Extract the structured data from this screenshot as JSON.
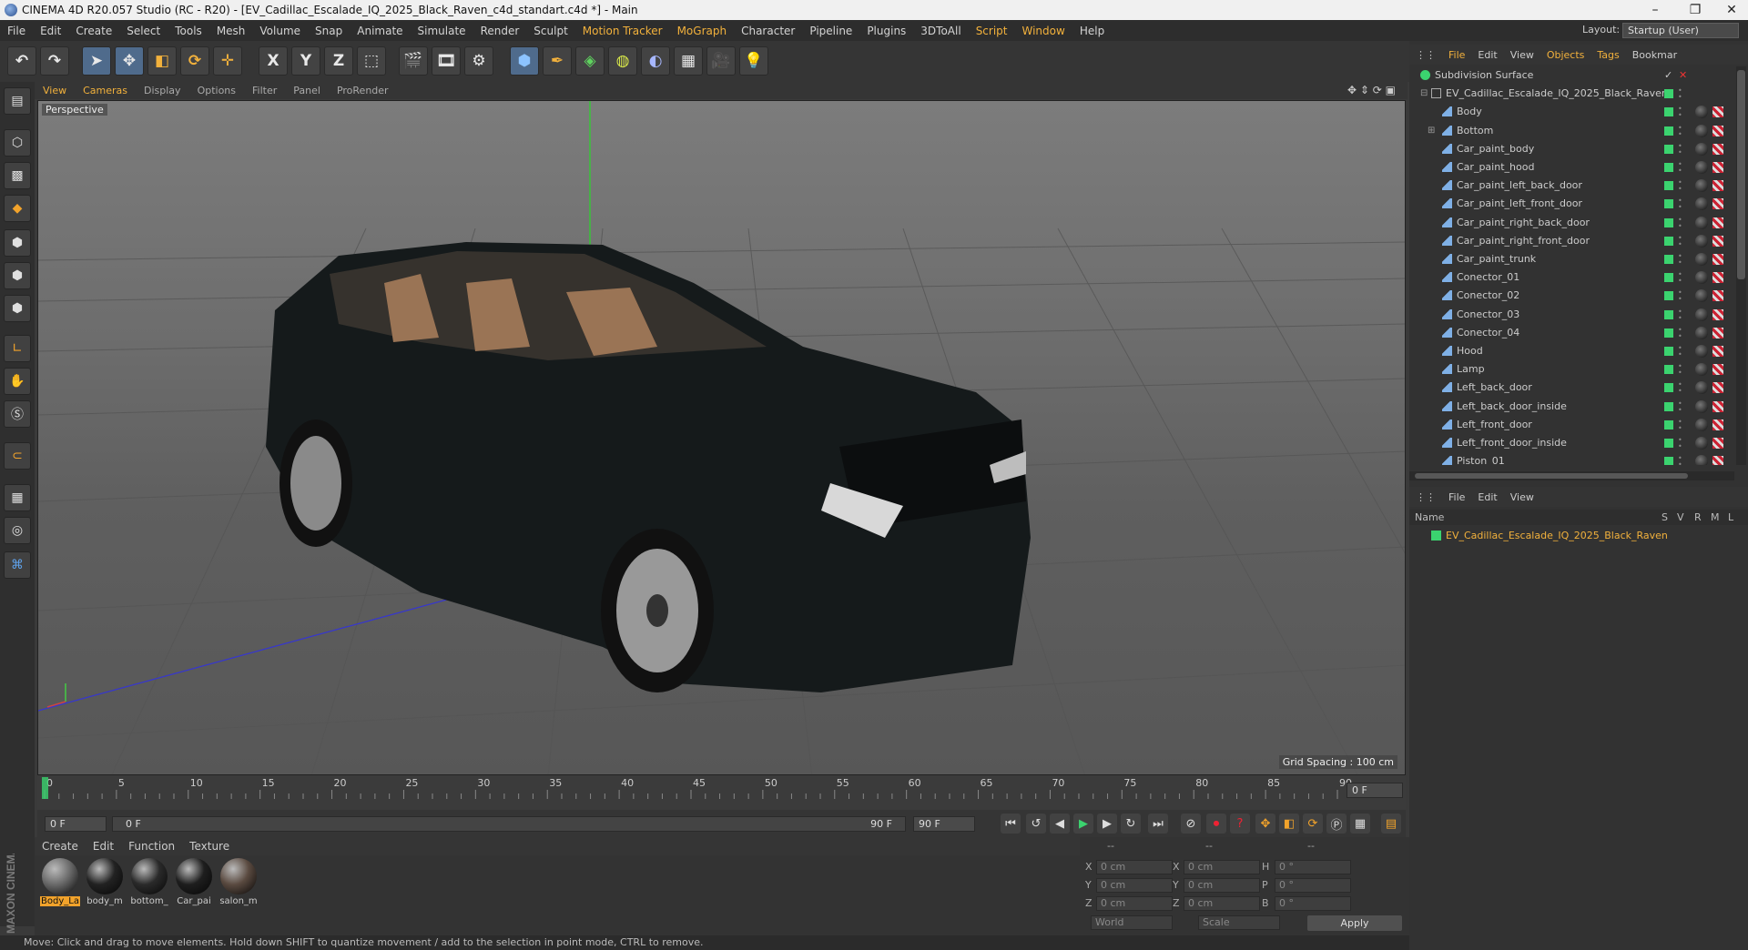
{
  "window": {
    "title": "CINEMA 4D R20.057 Studio (RC - R20) - [EV_Cadillac_Escalade_IQ_2025_Black_Raven_c4d_standart.c4d *] - Main"
  },
  "menubar": [
    {
      "label": "File"
    },
    {
      "label": "Edit"
    },
    {
      "label": "Create"
    },
    {
      "label": "Select"
    },
    {
      "label": "Tools"
    },
    {
      "label": "Mesh"
    },
    {
      "label": "Volume"
    },
    {
      "label": "Snap"
    },
    {
      "label": "Animate"
    },
    {
      "label": "Simulate"
    },
    {
      "label": "Render"
    },
    {
      "label": "Sculpt"
    },
    {
      "label": "Motion Tracker",
      "hl": true
    },
    {
      "label": "MoGraph",
      "hl": true
    },
    {
      "label": "Character"
    },
    {
      "label": "Pipeline"
    },
    {
      "label": "Plugins"
    },
    {
      "label": "3DToAll"
    },
    {
      "label": "Script",
      "hl": true
    },
    {
      "label": "Window",
      "hl": true
    },
    {
      "label": "Help"
    }
  ],
  "layout": {
    "label": "Layout:",
    "value": "Startup (User)"
  },
  "toolbar": {
    "x_axis": "X",
    "y_axis": "Y",
    "z_axis": "Z"
  },
  "viewport": {
    "menu": [
      "View",
      "Cameras",
      "Display",
      "Options",
      "Filter",
      "Panel",
      "ProRender"
    ],
    "camera_label": "Perspective",
    "grid_spacing": "Grid Spacing : 100 cm"
  },
  "timeline": {
    "ticks": [
      "0",
      "5",
      "10",
      "15",
      "20",
      "25",
      "30",
      "35",
      "40",
      "45",
      "50",
      "55",
      "60",
      "65",
      "70",
      "75",
      "80",
      "85",
      "90"
    ],
    "current_frame": "0 F",
    "start_field": "0 F",
    "range_start": "0 F",
    "range_end": "90 F",
    "end_field": "90 F"
  },
  "materials": {
    "menu": [
      "Create",
      "Edit",
      "Function",
      "Texture"
    ],
    "items": [
      {
        "label": "Body_La",
        "selected": true,
        "color": "#6a6a6a"
      },
      {
        "label": "body_m",
        "selected": false,
        "color": "#222"
      },
      {
        "label": "bottom_",
        "selected": false,
        "color": "#2a2a2a"
      },
      {
        "label": "Car_pai",
        "selected": false,
        "color": "#1e1e1e"
      },
      {
        "label": "salon_m",
        "selected": false,
        "color": "#5a4a40"
      }
    ]
  },
  "coords": {
    "headers": [
      "--",
      "--",
      "--"
    ],
    "rows": [
      {
        "a": "X",
        "av": "0 cm",
        "b": "X",
        "bv": "0 cm",
        "c": "H",
        "cv": "0 °"
      },
      {
        "a": "Y",
        "av": "0 cm",
        "b": "Y",
        "bv": "0 cm",
        "c": "P",
        "cv": "0 °"
      },
      {
        "a": "Z",
        "av": "0 cm",
        "b": "Z",
        "bv": "0 cm",
        "c": "B",
        "cv": "0 °"
      }
    ],
    "world": "World",
    "scale": "Scale",
    "apply": "Apply"
  },
  "status": "Move: Click and drag to move elements. Hold down SHIFT to quantize movement / add to the selection in point mode, CTRL to remove.",
  "brand": "MAXON CINEMA 4D",
  "objects_panel": {
    "menu": [
      {
        "label": "File",
        "hl": true
      },
      {
        "label": "Edit"
      },
      {
        "label": "View"
      },
      {
        "label": "Objects",
        "hl": true
      },
      {
        "label": "Tags",
        "hl": true
      },
      {
        "label": "Bookmar"
      }
    ],
    "items": [
      {
        "name": "Subdivision Surface",
        "depth": 0,
        "type": "subdiv"
      },
      {
        "name": "EV_Cadillac_Escalade_IQ_2025_Black_Raven",
        "depth": 1,
        "type": "null"
      },
      {
        "name": "Body",
        "depth": 2,
        "type": "poly"
      },
      {
        "name": "Bottom",
        "depth": 2,
        "type": "poly",
        "expand": true
      },
      {
        "name": "Car_paint_body",
        "depth": 2,
        "type": "poly"
      },
      {
        "name": "Car_paint_hood",
        "depth": 2,
        "type": "poly"
      },
      {
        "name": "Car_paint_left_back_door",
        "depth": 2,
        "type": "poly"
      },
      {
        "name": "Car_paint_left_front_door",
        "depth": 2,
        "type": "poly"
      },
      {
        "name": "Car_paint_right_back_door",
        "depth": 2,
        "type": "poly"
      },
      {
        "name": "Car_paint_right_front_door",
        "depth": 2,
        "type": "poly"
      },
      {
        "name": "Car_paint_trunk",
        "depth": 2,
        "type": "poly"
      },
      {
        "name": "Conector_01",
        "depth": 2,
        "type": "poly"
      },
      {
        "name": "Conector_02",
        "depth": 2,
        "type": "poly"
      },
      {
        "name": "Conector_03",
        "depth": 2,
        "type": "poly"
      },
      {
        "name": "Conector_04",
        "depth": 2,
        "type": "poly"
      },
      {
        "name": "Hood",
        "depth": 2,
        "type": "poly"
      },
      {
        "name": "Lamp",
        "depth": 2,
        "type": "poly"
      },
      {
        "name": "Left_back_door",
        "depth": 2,
        "type": "poly"
      },
      {
        "name": "Left_back_door_inside",
        "depth": 2,
        "type": "poly"
      },
      {
        "name": "Left_front_door",
        "depth": 2,
        "type": "poly"
      },
      {
        "name": "Left_front_door_inside",
        "depth": 2,
        "type": "poly"
      },
      {
        "name": "Piston_01",
        "depth": 2,
        "type": "poly"
      }
    ]
  },
  "layers_panel": {
    "menu": [
      {
        "label": "File"
      },
      {
        "label": "Edit"
      },
      {
        "label": "View"
      }
    ],
    "headers": {
      "name": "Name",
      "s": "S",
      "v": "V",
      "r": "R",
      "m": "M",
      "l": "L"
    },
    "items": [
      {
        "name": "EV_Cadillac_Escalade_IQ_2025_Black_Raven"
      }
    ]
  },
  "colors": {
    "accent": "#f2b13c",
    "active": "#3bd36f"
  }
}
